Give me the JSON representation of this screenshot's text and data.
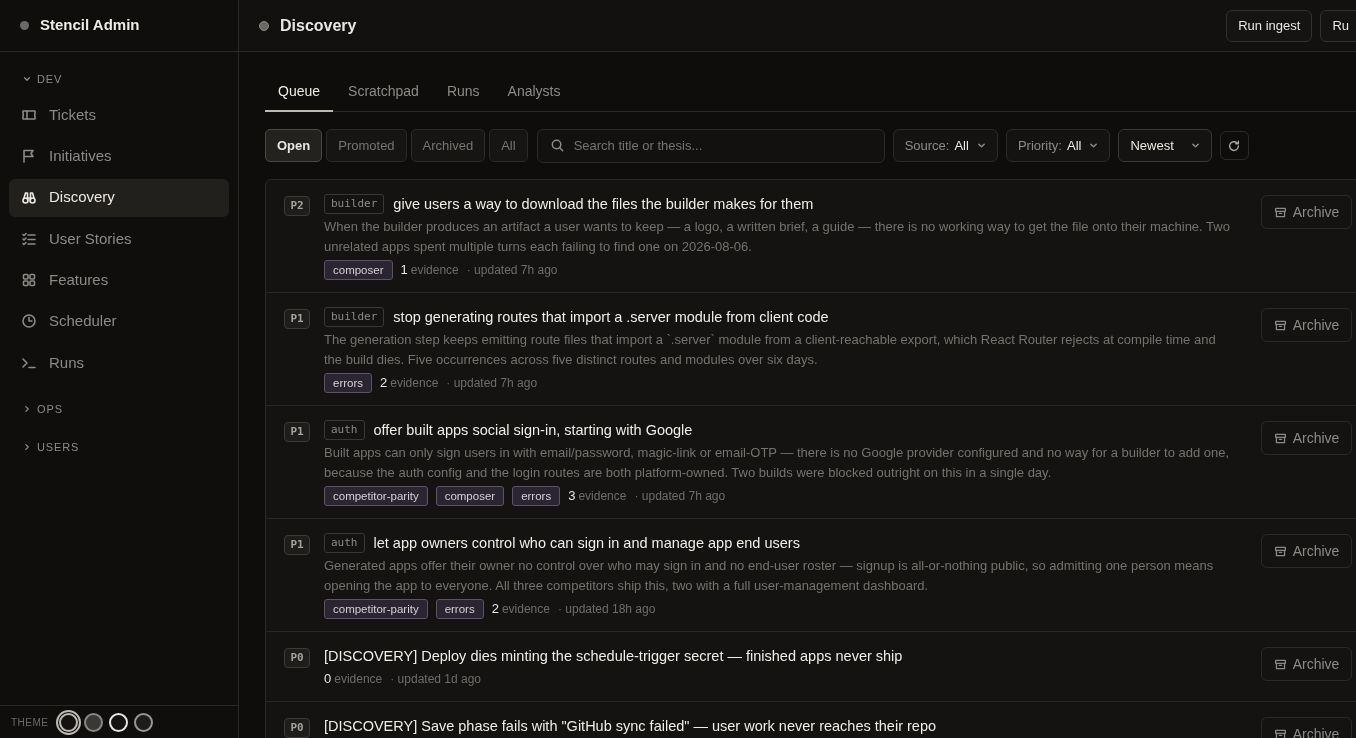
{
  "app": {
    "title": "Stencil Admin"
  },
  "sidebar": {
    "sections": [
      {
        "label": "DEV",
        "expanded": true,
        "items": [
          {
            "label": "Tickets",
            "selected": false
          },
          {
            "label": "Initiatives",
            "selected": false
          },
          {
            "label": "Discovery",
            "selected": true
          },
          {
            "label": "User Stories",
            "selected": false
          },
          {
            "label": "Features",
            "selected": false
          },
          {
            "label": "Scheduler",
            "selected": false
          },
          {
            "label": "Runs",
            "selected": false
          }
        ]
      },
      {
        "label": "OPS",
        "expanded": false
      },
      {
        "label": "USERS",
        "expanded": false
      }
    ],
    "theme": {
      "label": "THEME",
      "options": [
        {
          "selected": true
        },
        {
          "selected": false
        },
        {
          "selected": false
        },
        {
          "selected": false
        }
      ]
    }
  },
  "header": {
    "title": "Discovery",
    "buttons": [
      "Run ingest",
      "Ru"
    ]
  },
  "tabs": [
    {
      "label": "Queue",
      "selected": true
    },
    {
      "label": "Scratchpad",
      "selected": false
    },
    {
      "label": "Runs",
      "selected": false
    },
    {
      "label": "Analysts",
      "selected": false
    }
  ],
  "filters": {
    "status": [
      {
        "label": "Open",
        "selected": true
      },
      {
        "label": "Promoted",
        "selected": false
      },
      {
        "label": "Archived",
        "selected": false
      },
      {
        "label": "All",
        "selected": false
      }
    ],
    "search": {
      "placeholder": "Search title or thesis..."
    },
    "source": {
      "label": "Source:",
      "value": "All"
    },
    "priority": {
      "label": "Priority:",
      "value": "All"
    },
    "sort": {
      "value": "Newest"
    }
  },
  "items": [
    {
      "priority": "P2",
      "category": "builder",
      "title": "give users a way to download the files the builder makes for them",
      "description": "When the builder produces an artifact a user wants to keep — a logo, a written brief, a guide — there is no working way to get the file onto their machine. Two unrelated apps spent multiple turns each failing to find one on 2026-08-06.",
      "tags": [
        "composer"
      ],
      "evidence_count": "1",
      "evidence_label": "evidence",
      "updated": "· updated 7h ago",
      "action": "Archive"
    },
    {
      "priority": "P1",
      "category": "builder",
      "title": "stop generating routes that import a .server module from client code",
      "description": "The generation step keeps emitting route files that import a `.server` module from a client-reachable export, which React Router rejects at compile time and the build dies. Five occurrences across five distinct routes and modules over six days.",
      "tags": [
        "errors"
      ],
      "evidence_count": "2",
      "evidence_label": "evidence",
      "updated": "· updated 7h ago",
      "action": "Archive"
    },
    {
      "priority": "P1",
      "category": "auth",
      "title": "offer built apps social sign-in, starting with Google",
      "description": "Built apps can only sign users in with email/password, magic-link or email-OTP — there is no Google provider configured and no way for a builder to add one, because the auth config and the login routes are both platform-owned. Two builds were blocked outright on this in a single day.",
      "tags": [
        "competitor-parity",
        "composer",
        "errors"
      ],
      "evidence_count": "3",
      "evidence_label": "evidence",
      "updated": "· updated 7h ago",
      "action": "Archive"
    },
    {
      "priority": "P1",
      "category": "auth",
      "title": "let app owners control who can sign in and manage app end users",
      "description": "Generated apps offer their owner no control over who may sign in and no end-user roster — signup is all-or-nothing public, so admitting one person means opening the app to everyone. All three competitors ship this, two with a full user-management dashboard.",
      "tags": [
        "competitor-parity",
        "errors"
      ],
      "evidence_count": "2",
      "evidence_label": "evidence",
      "updated": "· updated 18h ago",
      "action": "Archive"
    },
    {
      "priority": "P0",
      "title": "[DISCOVERY] Deploy dies minting the schedule-trigger secret — finished apps never ship",
      "evidence_count": "0",
      "evidence_label": "evidence",
      "updated": "· updated 1d ago",
      "action": "Archive"
    },
    {
      "priority": "P0",
      "title": "[DISCOVERY] Save phase fails with \"GitHub sync failed\" — user work never reaches their repo",
      "action": "Archive"
    }
  ]
}
